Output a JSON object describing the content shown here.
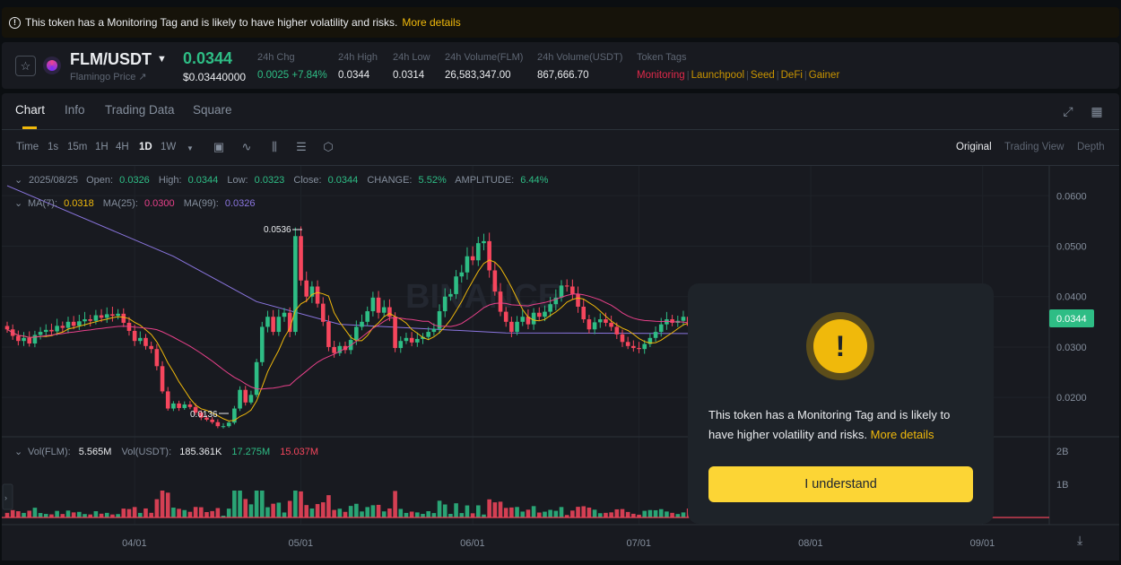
{
  "banner": {
    "icon": "warning-circle-icon",
    "text": "This token has a Monitoring Tag and is likely to have higher volatility and risks.",
    "link": "More details"
  },
  "header": {
    "favorite_icon": "star-icon",
    "coin_icon": "flamingo-coin-icon",
    "pair": "FLM/USDT",
    "pair_caret": "▼",
    "subtitle": "Flamingo Price ↗",
    "last_price": "0.0344",
    "last_price_usd": "$0.03440000",
    "stats": [
      {
        "label": "24h Chg",
        "value": "0.0025 +7.84%",
        "positive": true
      },
      {
        "label": "24h High",
        "value": "0.0344"
      },
      {
        "label": "24h Low",
        "value": "0.0314"
      },
      {
        "label": "24h Volume(FLM)",
        "value": "26,583,347.00"
      },
      {
        "label": "24h Volume(USDT)",
        "value": "867,666.70"
      }
    ],
    "token_tags_label": "Token Tags",
    "tags": [
      {
        "text": "Monitoring",
        "color": "#e0294a"
      },
      {
        "text": "Launchpool",
        "color": "#c99400"
      },
      {
        "text": "Seed",
        "color": "#c99400"
      },
      {
        "text": "DeFi",
        "color": "#c99400"
      },
      {
        "text": "Gainer",
        "color": "#c99400"
      }
    ],
    "tag_separator": "|"
  },
  "tabs": [
    "Chart",
    "Info",
    "Trading Data",
    "Square"
  ],
  "tab_icons": [
    "expand-icon",
    "grid-layout-icon"
  ],
  "toolbar": {
    "time_label": "Time",
    "intervals": [
      "1s",
      "15m",
      "1H",
      "4H",
      "1D",
      "1W"
    ],
    "active_interval": "1D",
    "dropdown": "▼",
    "tool_icons": [
      "calendar-icon",
      "indicator-icon",
      "candle-type-icon",
      "settings-icon",
      "hexagon-icon"
    ],
    "views": [
      "Original",
      "Trading View",
      "Depth"
    ],
    "active_view": "Original"
  },
  "ohlc": {
    "date": "2025/08/25",
    "open_label": "Open:",
    "open": "0.0326",
    "high_label": "High:",
    "high": "0.0344",
    "low_label": "Low:",
    "low": "0.0323",
    "close_label": "Close:",
    "close": "0.0344",
    "change_label": "CHANGE:",
    "change": "5.52%",
    "amplitude_label": "AMPLITUDE:",
    "amplitude": "6.44%"
  },
  "ma": {
    "ma7_label": "MA(7):",
    "ma7": "0.0318",
    "ma25_label": "MA(25):",
    "ma25": "0.0300",
    "ma99_label": "MA(99):",
    "ma99": "0.0326"
  },
  "vol": {
    "flm_label": "Vol(FLM):",
    "flm": "5.565M",
    "usdt_label": "Vol(USDT):",
    "usdt": "185.361K",
    "ma_a": "17.275M",
    "ma_b": "15.037M"
  },
  "watermark": "BINANCE",
  "colors": {
    "up": "#2ebd85",
    "down": "#f6465d",
    "ma7": "#f0b90b",
    "ma25": "#e8418a",
    "ma99": "#8b76e0",
    "accent": "#f0b90b",
    "button": "#fcd535"
  },
  "chart_data": {
    "type": "candlestick",
    "price_axis": [
      "0.0600",
      "0.0500",
      "0.0400",
      "0.0300",
      "0.0200"
    ],
    "ylim": [
      0.0122,
      0.0645
    ],
    "current_price_label": "0.0344",
    "high_marker": "0.0536",
    "low_marker": "0.0136",
    "volume_axis": [
      "2B",
      "1B"
    ],
    "time_axis": [
      "04/01",
      "05/01",
      "06/01",
      "07/01",
      "08/01",
      "09/01"
    ],
    "time_axis_days": [
      0,
      30,
      61,
      91,
      122,
      153
    ],
    "candles_close": [
      0.0335,
      0.0322,
      0.0312,
      0.0318,
      0.0307,
      0.0324,
      0.033,
      0.0334,
      0.0331,
      0.0342,
      0.0338,
      0.035,
      0.0342,
      0.0351,
      0.0355,
      0.0352,
      0.0363,
      0.0358,
      0.0365,
      0.0362,
      0.0366,
      0.0348,
      0.0332,
      0.0312,
      0.0318,
      0.0302,
      0.0296,
      0.0262,
      0.0212,
      0.0178,
      0.0188,
      0.0179,
      0.0186,
      0.0181,
      0.017,
      0.016,
      0.0156,
      0.0151,
      0.0143,
      0.0143,
      0.015,
      0.0178,
      0.0215,
      0.019,
      0.0205,
      0.027,
      0.034,
      0.036,
      0.033,
      0.036,
      0.0368,
      0.033,
      0.052,
      0.0432,
      0.04,
      0.042,
      0.0386,
      0.035,
      0.03,
      0.0288,
      0.0302,
      0.0294,
      0.0314,
      0.034,
      0.035,
      0.0371,
      0.0398,
      0.0368,
      0.0379,
      0.036,
      0.0298,
      0.0312,
      0.0318,
      0.0309,
      0.0316,
      0.032,
      0.033,
      0.0336,
      0.0371,
      0.04,
      0.0405,
      0.044,
      0.0448,
      0.048,
      0.0472,
      0.0506,
      0.051,
      0.0452,
      0.041,
      0.037,
      0.035,
      0.033,
      0.035,
      0.036,
      0.0345,
      0.0368,
      0.036,
      0.037,
      0.0385,
      0.0398,
      0.0422,
      0.042,
      0.0405,
      0.038,
      0.0355,
      0.0335,
      0.0349,
      0.0355,
      0.0348,
      0.034,
      0.0325,
      0.031,
      0.0302,
      0.0298,
      0.0296,
      0.0306,
      0.0318,
      0.033,
      0.0345,
      0.0355,
      0.0348,
      0.0352,
      0.036,
      0.0342,
      0.035,
      0.034,
      0.0334,
      0.0344,
      0.0336,
      0.032,
      0.0296,
      0.0285,
      0.0295,
      0.0305,
      0.03,
      0.031,
      0.0305,
      0.032,
      0.0315,
      0.0326,
      0.0318,
      0.0322,
      0.0333,
      0.0326,
      0.0344
    ],
    "ma99_points": [
      [
        0,
        0.062
      ],
      [
        30,
        0.048
      ],
      [
        45,
        0.039
      ],
      [
        60,
        0.0345
      ],
      [
        90,
        0.0328
      ],
      [
        144,
        0.0326
      ]
    ]
  },
  "modal": {
    "icon": "exclamation-icon",
    "message": "This token has a Monitoring Tag and is likely to have higher volatility and risks.",
    "link": "More details",
    "button": "I understand"
  }
}
